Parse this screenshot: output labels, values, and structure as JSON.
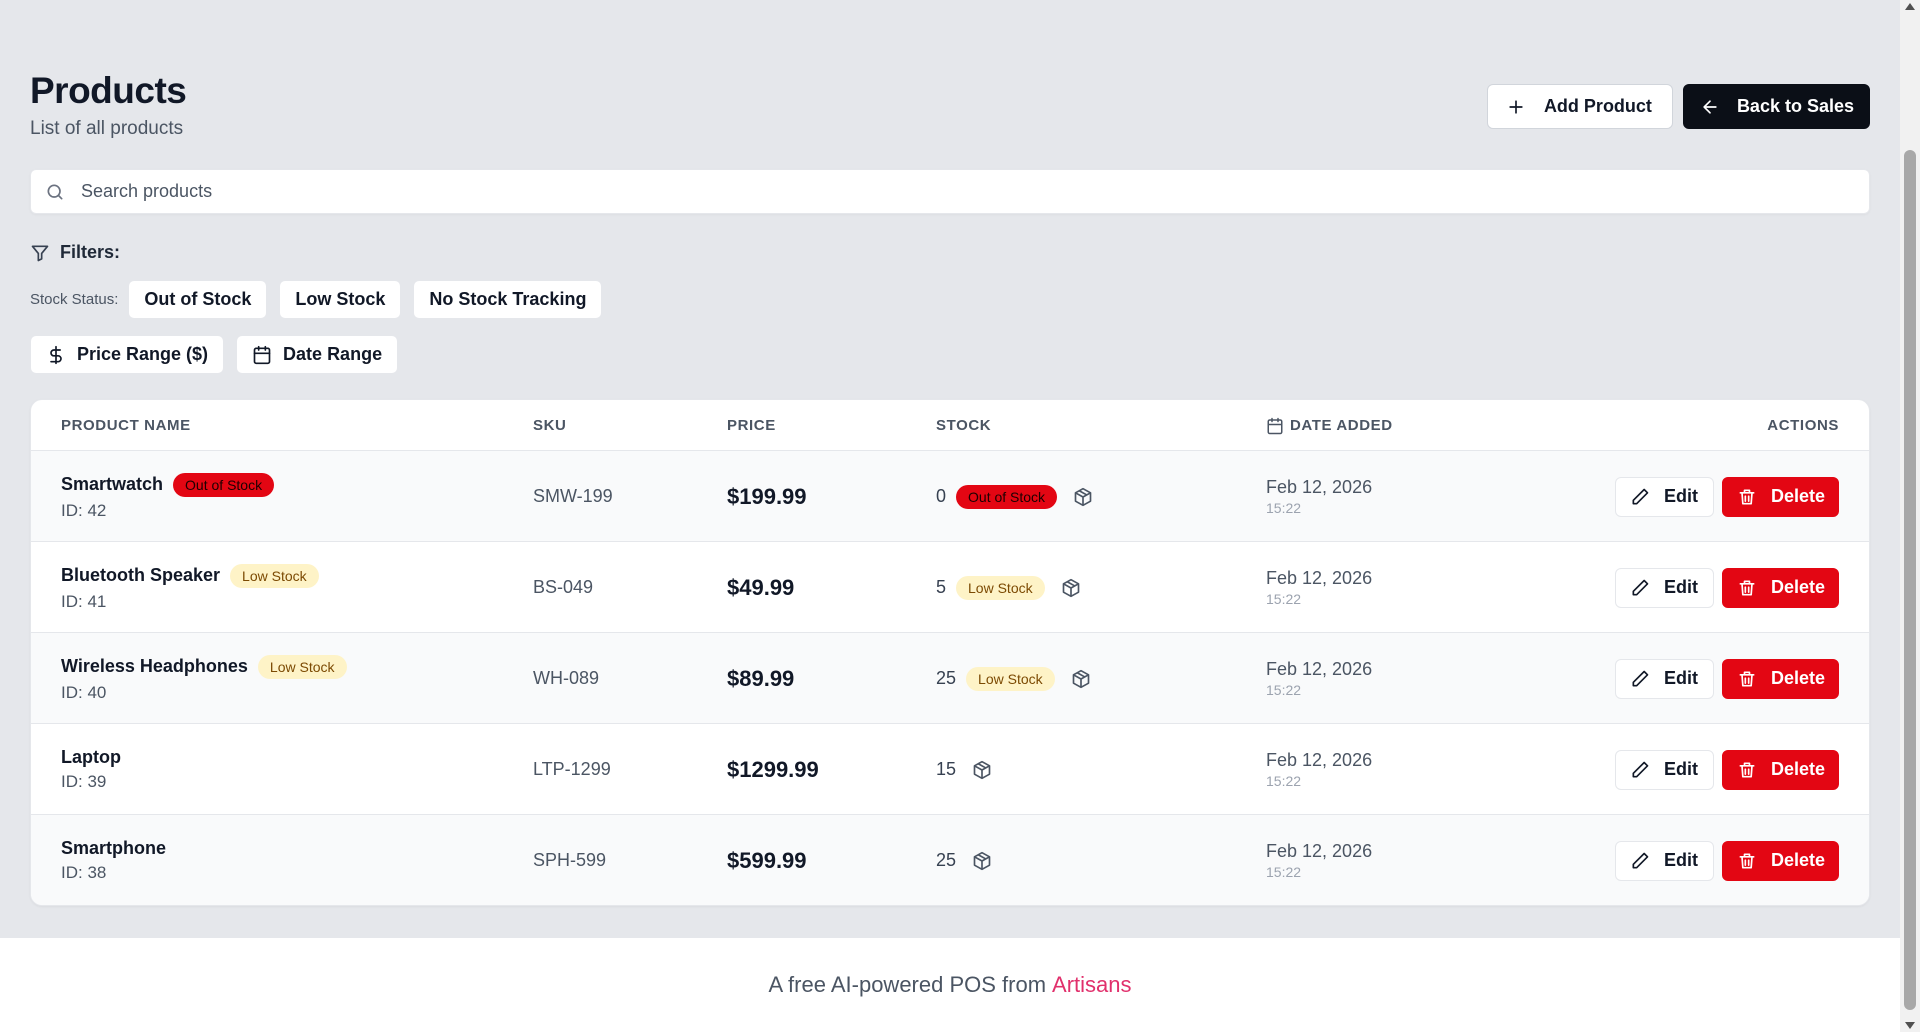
{
  "header": {
    "title": "Products",
    "subtitle": "List of all products",
    "add_label": "Add Product",
    "back_label": "Back to Sales"
  },
  "search": {
    "placeholder": "Search products",
    "value": ""
  },
  "filters": {
    "label": "Filters:",
    "stock_status_label": "Stock Status:",
    "stock_options": [
      "Out of Stock",
      "Low Stock",
      "No Stock Tracking"
    ],
    "price_range_label": "Price Range ($)",
    "date_range_label": "Date Range"
  },
  "table": {
    "headers": {
      "product_name": "PRODUCT NAME",
      "sku": "SKU",
      "price": "PRICE",
      "stock": "STOCK",
      "date_added": "DATE ADDED",
      "actions": "ACTIONS"
    },
    "edit_label": "Edit",
    "delete_label": "Delete",
    "rows": [
      {
        "name": "Smartwatch",
        "badge": "Out of Stock",
        "badge_type": "out",
        "id": "ID: 42",
        "sku": "SMW-199",
        "price": "$199.99",
        "stock": "0",
        "stock_badge": "Out of Stock",
        "stock_badge_type": "out",
        "date": "Feb 12, 2026",
        "time": "15:22"
      },
      {
        "name": "Bluetooth Speaker",
        "badge": "Low Stock",
        "badge_type": "low",
        "id": "ID: 41",
        "sku": "BS-049",
        "price": "$49.99",
        "stock": "5",
        "stock_badge": "Low Stock",
        "stock_badge_type": "low",
        "date": "Feb 12, 2026",
        "time": "15:22"
      },
      {
        "name": "Wireless Headphones",
        "badge": "Low Stock",
        "badge_type": "low",
        "id": "ID: 40",
        "sku": "WH-089",
        "price": "$89.99",
        "stock": "25",
        "stock_badge": "Low Stock",
        "stock_badge_type": "low",
        "date": "Feb 12, 2026",
        "time": "15:22"
      },
      {
        "name": "Laptop",
        "badge": "",
        "badge_type": "",
        "id": "ID: 39",
        "sku": "LTP-1299",
        "price": "$1299.99",
        "stock": "15",
        "stock_badge": "",
        "stock_badge_type": "",
        "date": "Feb 12, 2026",
        "time": "15:22"
      },
      {
        "name": "Smartphone",
        "badge": "",
        "badge_type": "",
        "id": "ID: 38",
        "sku": "SPH-599",
        "price": "$599.99",
        "stock": "25",
        "stock_badge": "",
        "stock_badge_type": "",
        "date": "Feb 12, 2026",
        "time": "15:22"
      }
    ]
  },
  "footer": {
    "text": "A free AI-powered POS from",
    "brand": "Artisans"
  },
  "colors": {
    "background": "#e5e7eb",
    "primary_dark": "#0b0f17",
    "danger": "#e30613",
    "low_stock_bg": "#fef3c7",
    "brand": "#e1306c"
  },
  "icons": {
    "add": "plus-icon",
    "back": "arrow-left-icon",
    "search": "search-icon",
    "filter": "filter-icon",
    "price": "dollar-icon",
    "date": "calendar-icon",
    "stock": "package-icon",
    "edit": "pencil-icon",
    "delete": "trash-icon"
  }
}
